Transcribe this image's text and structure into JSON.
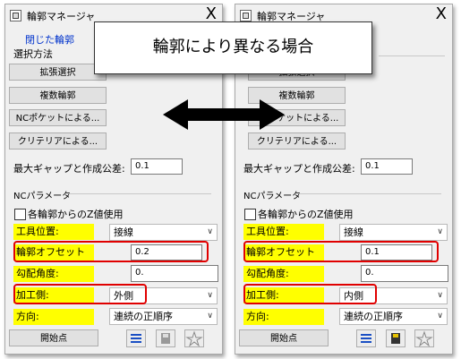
{
  "left": {
    "title": "輪郭マネージャ",
    "close_glyph": "X",
    "link": "閉じた輪郭",
    "select_label": "選択方法",
    "buttons": [
      "拡張選択",
      "複数輪郭",
      "NCポケットによる...",
      "クリテリアによる..."
    ],
    "max_gap_label": "最大ギャップと作成公差:",
    "max_gap_value": "0.1",
    "nc_params_label": "NCパラメータ",
    "z_checkbox_label": "各輪郭からのZ値使用",
    "tool_pos_label": "工具位置:",
    "tool_pos_value": "接線",
    "offset_label": "輪郭オフセット",
    "offset_value": "0.2",
    "slope_label": "勾配角度:",
    "slope_value": "0.",
    "side_label": "加工側:",
    "side_value": "外側",
    "direction_label": "方向:",
    "direction_value": "連続の正順序",
    "start_button": "開始点"
  },
  "right": {
    "title": "輪郭マネージャ",
    "close_glyph": "X",
    "buttons": [
      "拡張選択",
      "複数輪郭",
      "NCポケットによる...",
      "クリテリアによる..."
    ],
    "max_gap_label": "最大ギャップと作成公差:",
    "max_gap_value": "0.1",
    "nc_params_label": "NCパラメータ",
    "z_checkbox_label": "各輪郭からのZ値使用",
    "tool_pos_label": "工具位置:",
    "tool_pos_value": "接線",
    "offset_label": "輪郭オフセット",
    "offset_value": "0.1",
    "slope_label": "勾配角度:",
    "slope_value": "0.",
    "side_label": "加工側:",
    "side_value": "内側",
    "direction_label": "方向:",
    "direction_value": "連続の正順序",
    "start_button": "開始点"
  },
  "callout": "輪郭により異なる場合",
  "colors": {
    "highlight": "#ffff00",
    "redbox": "#e00000",
    "link": "#0033cc"
  },
  "icons": [
    "app-icon",
    "close-icon",
    "chevron-down-icon",
    "list-icon",
    "save-icon",
    "star-icon",
    "double-arrow-icon"
  ]
}
